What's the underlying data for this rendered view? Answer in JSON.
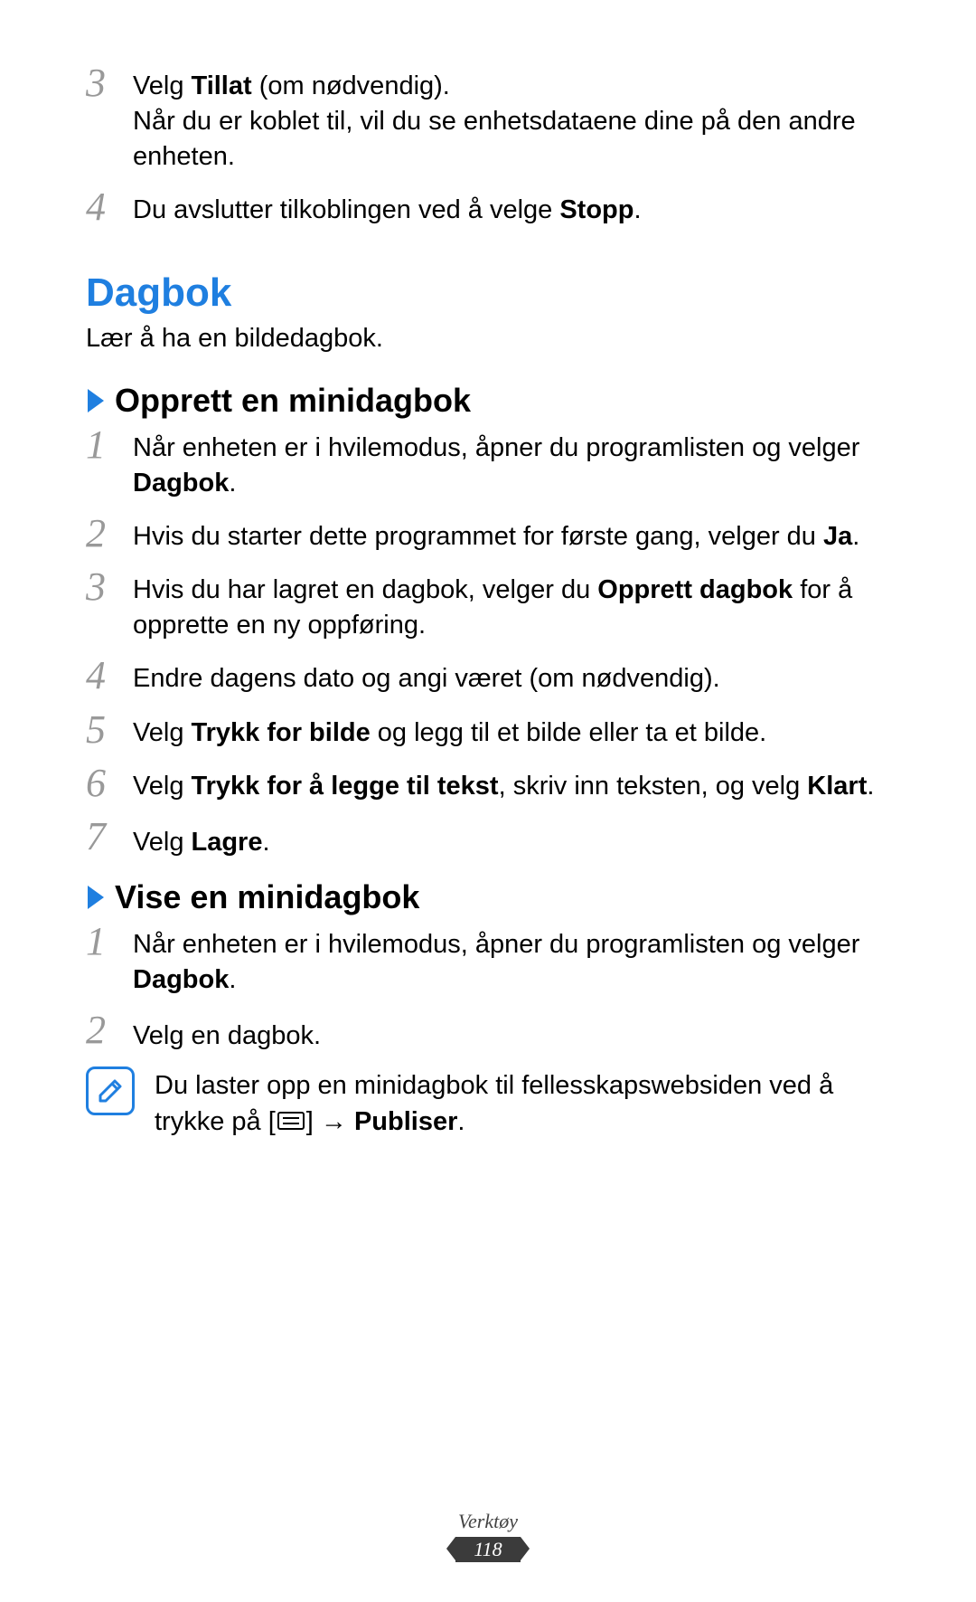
{
  "top_steps": {
    "s3_num": "3",
    "s3_text_prefix": "Velg ",
    "s3_bold": "Tillat",
    "s3_text_suffix": " (om nødvendig).",
    "s3_line2": "Når du er koblet til, vil du se enhetsdataene dine på den andre enheten.",
    "s4_num": "4",
    "s4_text_prefix": "Du avslutter tilkoblingen ved å velge ",
    "s4_bold": "Stopp",
    "s4_text_suffix": "."
  },
  "section": {
    "title": "Dagbok",
    "subtitle": "Lær å ha en bildedagbok."
  },
  "create": {
    "heading": "Opprett en minidagbok",
    "s1_num": "1",
    "s1_prefix": "Når enheten er i hvilemodus, åpner du programlisten og velger ",
    "s1_bold": "Dagbok",
    "s1_suffix": ".",
    "s2_num": "2",
    "s2_prefix": "Hvis du starter dette programmet for første gang, velger du ",
    "s2_bold": "Ja",
    "s2_suffix": ".",
    "s3_num": "3",
    "s3_prefix": "Hvis du har lagret en dagbok, velger du ",
    "s3_bold": "Opprett dagbok",
    "s3_suffix": " for å opprette en ny oppføring.",
    "s4_num": "4",
    "s4_text": "Endre dagens dato og angi været (om nødvendig).",
    "s5_num": "5",
    "s5_prefix": "Velg ",
    "s5_bold": "Trykk for bilde",
    "s5_suffix": " og legg til et bilde eller ta et bilde.",
    "s6_num": "6",
    "s6_prefix": "Velg ",
    "s6_bold1": "Trykk for å legge til tekst",
    "s6_mid": ", skriv inn teksten, og velg ",
    "s6_bold2": "Klart",
    "s6_suffix": ".",
    "s7_num": "7",
    "s7_prefix": "Velg ",
    "s7_bold": "Lagre",
    "s7_suffix": "."
  },
  "view": {
    "heading": "Vise en minidagbok",
    "s1_num": "1",
    "s1_prefix": "Når enheten er i hvilemodus, åpner du programlisten og velger ",
    "s1_bold": "Dagbok",
    "s1_suffix": ".",
    "s2_num": "2",
    "s2_text": "Velg en dagbok.",
    "note_prefix": "Du laster opp en minidagbok til fellesskapswebsiden ved å trykke på [",
    "note_mid": "] → ",
    "note_bold": "Publiser",
    "note_suffix": "."
  },
  "footer": {
    "label": "Verktøy",
    "page": "118"
  }
}
